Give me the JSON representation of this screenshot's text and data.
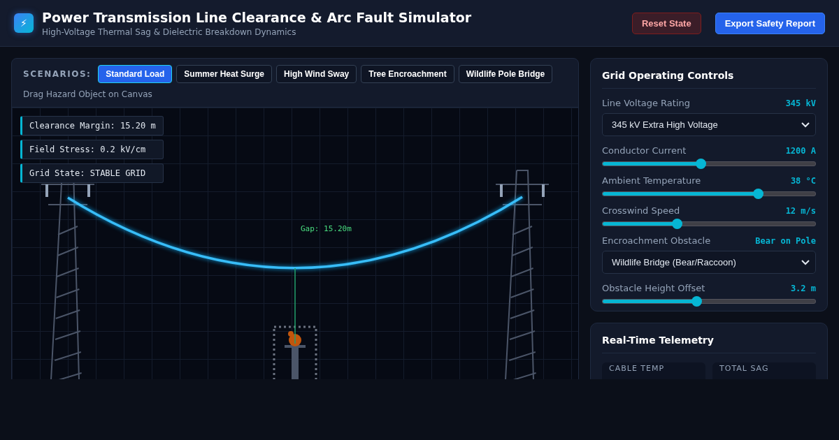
{
  "header": {
    "logo": "⚡",
    "title": "Power Transmission Line Clearance & Arc Fault Simulator",
    "subtitle": "High-Voltage Thermal Sag & Dielectric Breakdown Dynamics",
    "buttons": [
      {
        "label": "Reset State",
        "kind": "reset"
      },
      {
        "label": "Export Safety Report",
        "kind": "export"
      }
    ]
  },
  "scenarios": {
    "label": "SCENARIOS:",
    "items": [
      {
        "label": "Standard Load",
        "selected": true
      },
      {
        "label": "Summer Heat Surge",
        "selected": false
      },
      {
        "label": "High Wind Sway",
        "selected": false
      },
      {
        "label": "Tree Encroachment",
        "selected": false
      },
      {
        "label": "Wildlife Pole Bridge",
        "selected": false
      }
    ],
    "hint": "Drag Hazard Object on Canvas"
  },
  "canvas": {
    "readouts": [
      "Clearance Margin: 15.20 m",
      "Field Stress: 0.2 kV/cm",
      "Grid State: STABLE GRID"
    ],
    "gap_label": "Gap: 15.20m"
  },
  "controls": {
    "title": "Grid Operating Controls",
    "items": [
      {
        "kind": "select",
        "label": "Line Voltage Rating",
        "reading": "345 kV",
        "value": "345 kV Extra High Voltage"
      },
      {
        "kind": "slider",
        "label": "Conductor Current",
        "reading": "1200 A",
        "level": 0.46
      },
      {
        "kind": "slider",
        "label": "Ambient Temperature",
        "reading": "38 °C",
        "level": 0.73
      },
      {
        "kind": "slider",
        "label": "Crosswind Speed",
        "reading": "12 m/s",
        "level": 0.35
      },
      {
        "kind": "select",
        "label": "Encroachment Obstacle",
        "reading": "Bear on Pole",
        "value": "Wildlife Bridge (Bear/Raccoon)"
      },
      {
        "kind": "slider",
        "label": "Obstacle Height Offset",
        "reading": "3.2 m",
        "level": 0.44
      }
    ]
  },
  "telemetry": {
    "title": "Real-Time Telemetry",
    "tiles": [
      {
        "label": "CABLE TEMP"
      },
      {
        "label": "TOTAL SAG"
      }
    ]
  }
}
